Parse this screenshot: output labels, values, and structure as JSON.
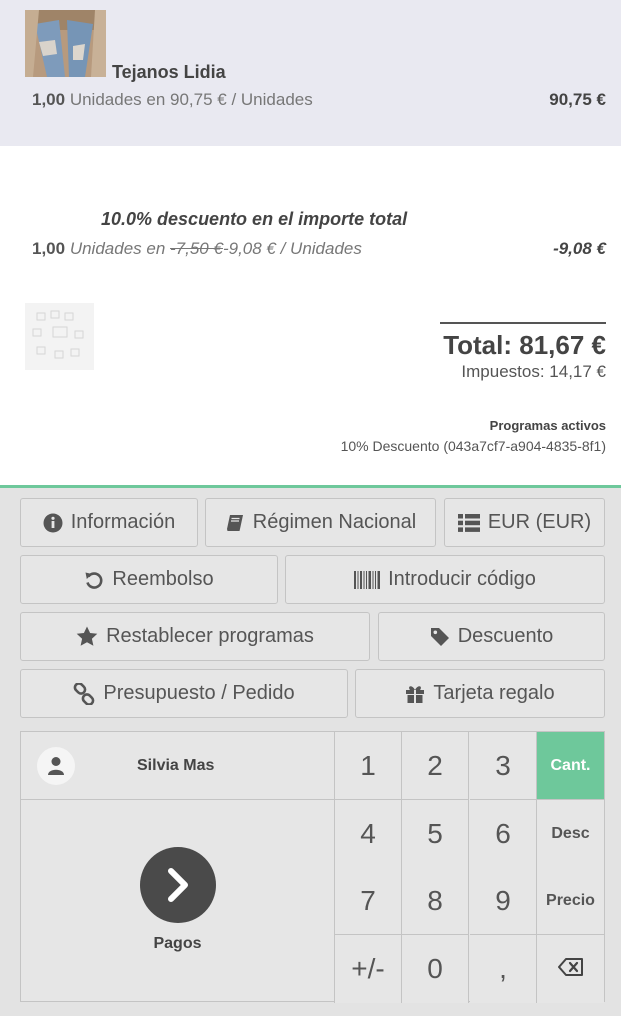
{
  "orderlines": [
    {
      "product_name": "Tejanos Lidia",
      "quantity": "1,00",
      "unit_text": "Unidades en 90,75 € / Unidades",
      "price": "90,75 €"
    },
    {
      "product_name": "10.0% descuento en el importe total",
      "quantity": "1,00",
      "unit_prefix": "Unidades en ",
      "old_price": "-7,50 €",
      "unit_suffix": "-9,08 € / Unidades",
      "price": "-9,08 €"
    }
  ],
  "summary": {
    "total": "Total: 81,67 €",
    "taxes": "Impuestos: 14,17 €",
    "programs_title": "Programas activos",
    "program_item": "10% Descuento (043a7cf7-a904-4835-8f1)"
  },
  "control_buttons": {
    "info": "Información",
    "fiscal": "Régimen Nacional",
    "currency": "EUR (EUR)",
    "refund": "Reembolso",
    "enter_code": "Introducir código",
    "reset_programs": "Restablecer programas",
    "discount": "Descuento",
    "quotation": "Presupuesto / Pedido",
    "gift_card": "Tarjeta regalo"
  },
  "customer": {
    "name": "Silvia Mas"
  },
  "payment": {
    "label": "Pagos"
  },
  "numpad": {
    "keys": [
      "1",
      "2",
      "3",
      "4",
      "5",
      "6",
      "7",
      "8",
      "9",
      "+/-",
      "0",
      ","
    ],
    "modes": {
      "quantity": "Cant.",
      "discount": "Desc",
      "price": "Precio"
    },
    "active_mode": "quantity"
  },
  "colors": {
    "accent": "#6ec89b",
    "selected_line": "#e9e9f1",
    "dark": "#4a4a4a"
  },
  "icons": [
    "info-icon",
    "book-icon",
    "list-icon",
    "undo-icon",
    "barcode-icon",
    "star-icon",
    "tag-icon",
    "link-icon",
    "gift-icon",
    "user-icon",
    "chevron-right-icon",
    "backspace-icon"
  ]
}
